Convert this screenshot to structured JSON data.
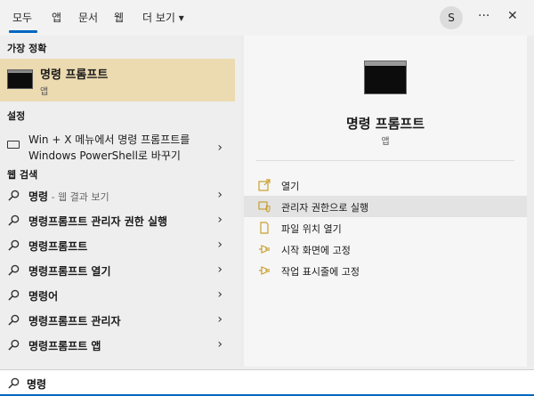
{
  "tabs": [
    {
      "label": "모두"
    },
    {
      "label": "앱"
    },
    {
      "label": "문서"
    },
    {
      "label": "웹"
    },
    {
      "label": "더 보기 ▾"
    }
  ],
  "avatar": {
    "initial": "S"
  },
  "top_actions": {
    "more": "···",
    "close": "✕"
  },
  "best_match": {
    "header": "가장 정확",
    "title": "명령 프롬프트",
    "subtitle": "앱"
  },
  "settings": {
    "header": "설정",
    "line1": "Win + X 메뉴에서 명령 프롬프트를",
    "line2": "Windows PowerShell로 바꾸기"
  },
  "web": {
    "header": "웹 검색",
    "items": [
      {
        "label": "명령",
        "suffix": " - 웹 결과 보기"
      },
      {
        "label": "명령프롬프트 관리자 권한 실행",
        "suffix": ""
      },
      {
        "label": "명령프롬프트",
        "suffix": ""
      },
      {
        "label": "명령프롬프트 열기",
        "suffix": ""
      },
      {
        "label": "명령어",
        "suffix": ""
      },
      {
        "label": "명령프롬프트 관리자",
        "suffix": ""
      },
      {
        "label": "명령프롬프트 앱",
        "suffix": ""
      }
    ]
  },
  "detail": {
    "title": "명령 프롬프트",
    "subtitle": "앱",
    "actions": [
      {
        "label": "열기",
        "icon": "open-icon"
      },
      {
        "label": "관리자 권한으로 실행",
        "icon": "admin-shield-icon"
      },
      {
        "label": "파일 위치 열기",
        "icon": "file-location-icon"
      },
      {
        "label": "시작 화면에 고정",
        "icon": "pin-icon"
      },
      {
        "label": "작업 표시줄에 고정",
        "icon": "pin-icon"
      }
    ]
  },
  "search": {
    "value": "명령"
  },
  "colors": {
    "accent": "#0067c0",
    "highlight": "#ecdab0",
    "icon_gold": "#c8a030"
  }
}
